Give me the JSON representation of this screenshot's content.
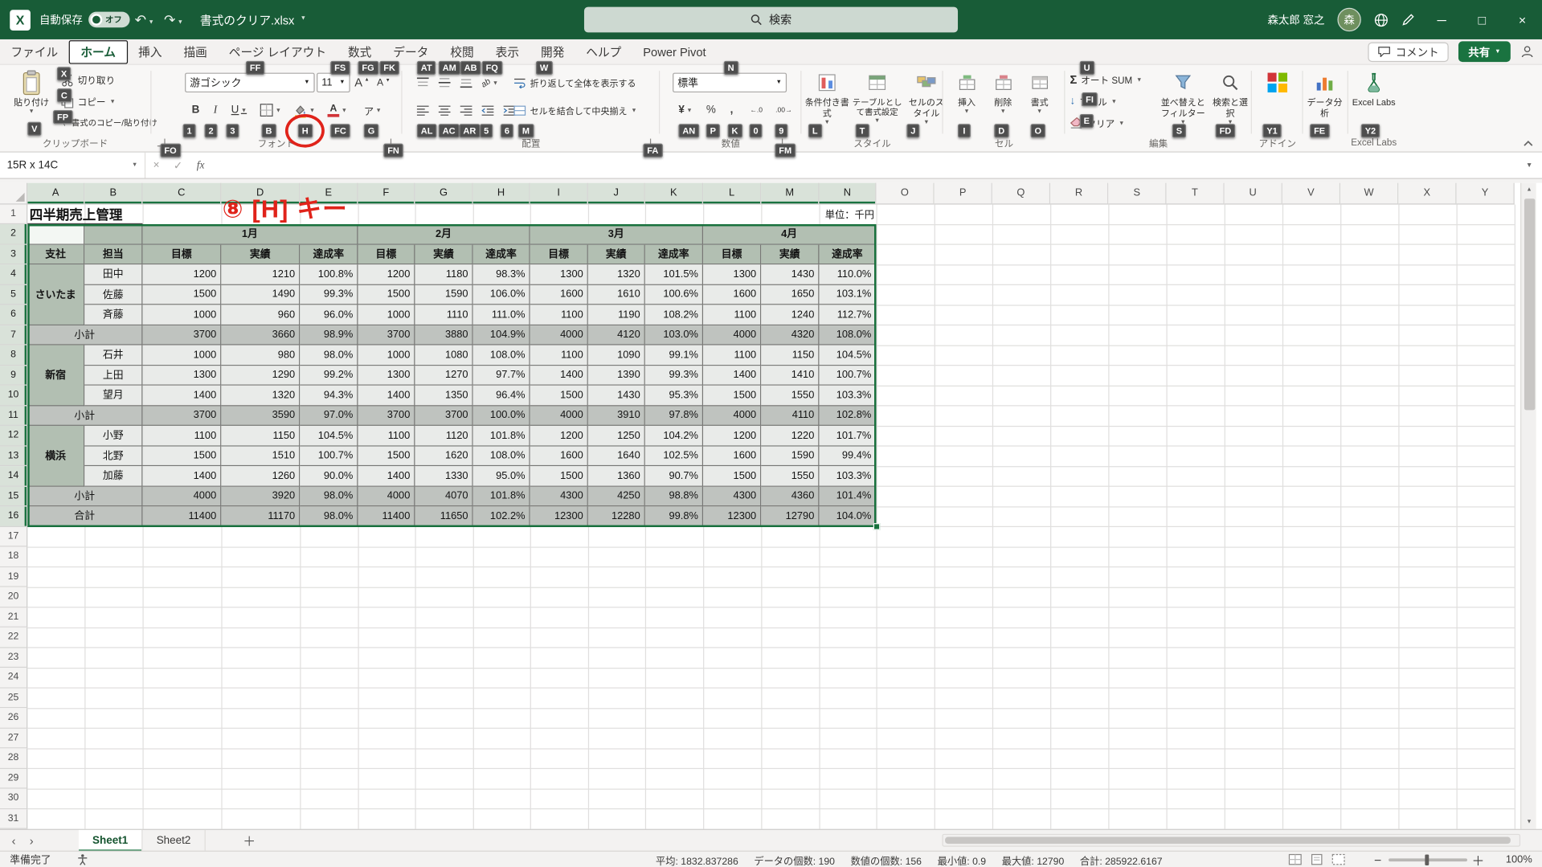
{
  "titlebar": {
    "autosave_label": "自動保存",
    "autosave_state": "オフ",
    "filename": "書式のクリア.xlsx",
    "search_placeholder": "検索",
    "user_name": "森太郎 窓之",
    "user_initial": "森"
  },
  "ribbon_tabs": {
    "items": [
      "ファイル",
      "ホーム",
      "挿入",
      "描画",
      "ページ レイアウト",
      "数式",
      "データ",
      "校閲",
      "表示",
      "開発",
      "ヘルプ",
      "Power Pivot"
    ],
    "active": "ホーム",
    "comments_label": "コメント",
    "share_label": "共有"
  },
  "ribbon": {
    "clipboard": {
      "title": "クリップボード",
      "paste": "貼り付け",
      "cut": "切り取り",
      "copy": "コピー",
      "format_painter": "書式のコピー/貼り付け"
    },
    "font": {
      "title": "フォント",
      "font_name": "游ゴシック",
      "font_size": "11",
      "bold": "B",
      "italic": "I",
      "underline": "U",
      "phonetic": "ア"
    },
    "alignment": {
      "title": "配置",
      "wrap_text": "折り返して全体を表示する",
      "merge_center": "セルを結合して中央揃え"
    },
    "number": {
      "title": "数値",
      "format": "標準",
      "currency": "¥",
      "percent": "%",
      "comma": ",",
      "inc": "←.0",
      "dec": ".00→"
    },
    "styles": {
      "title": "スタイル",
      "conditional": "条件付き書式",
      "format_table": "テーブルとして書式設定",
      "cell_styles": "セルのスタイル"
    },
    "cells": {
      "title": "セル",
      "insert": "挿入",
      "delete": "削除",
      "format": "書式"
    },
    "editing": {
      "title": "編集",
      "autosum": "オート SUM",
      "fill": "フィル",
      "clear": "クリア",
      "sort_filter": "並べ替えとフィルター",
      "find_select": "検索と選択"
    },
    "addins": {
      "title": "アドイン",
      "data_analysis": "データ分析",
      "excel_labs": "Excel Labs"
    }
  },
  "keytips": {
    "cut": "X",
    "copy": "C",
    "format_painter": "FP",
    "paste": "V",
    "clipboard_launcher": "FO",
    "font_name": "FF",
    "font_size": "FS",
    "grow_font": "FG",
    "shrink_font": "FK",
    "bold": "1",
    "italic": "2",
    "underline": "3",
    "borders": "B",
    "fill_color": "H",
    "font_color": "FC",
    "phonetic": "G",
    "font_launcher": "FN",
    "align_top": "AT",
    "align_middle": "AM",
    "align_bottom": "AB",
    "orientation": "FQ",
    "wrap_text": "W",
    "align_left": "AL",
    "align_center": "AC",
    "align_right": "AR",
    "outdent": "5",
    "indent": "6",
    "merge_center": "M",
    "alignment_launcher": "FA",
    "number_format": "N",
    "accounting": "AN",
    "percent": "P",
    "comma": "K",
    "increase_decimal": "0",
    "decrease_decimal": "9",
    "number_launcher": "FM",
    "conditional_formatting": "L",
    "format_as_table": "T",
    "cell_styles": "J",
    "insert": "I",
    "delete": "D",
    "format": "O",
    "autosum": "U",
    "fill": "FI",
    "clear": "E",
    "sort_filter": "S",
    "find_select": "FD",
    "addins": "Y1",
    "data_analysis": "FE",
    "excel_labs": "Y2"
  },
  "formula_bar": {
    "name_box": "15R x 14C",
    "fx": "fx"
  },
  "annotation": {
    "text": "⑧ [H] キー"
  },
  "sheet": {
    "columns": [
      "A",
      "B",
      "C",
      "D",
      "E",
      "F",
      "G",
      "H",
      "I",
      "J",
      "K",
      "L",
      "M",
      "N",
      "O",
      "P",
      "Q",
      "R",
      "S",
      "T",
      "U",
      "V",
      "W",
      "X",
      "Y"
    ],
    "rows": 31,
    "title_cell": "四半期売上管理",
    "unit_cell": "単位：千円"
  },
  "table": {
    "months": [
      "1月",
      "2月",
      "3月",
      "4月"
    ],
    "headers": {
      "branch": "支社",
      "person": "担当",
      "target": "目標",
      "actual": "実績",
      "rate": "達成率"
    },
    "groups": [
      {
        "branch": "さいたま",
        "members": [
          {
            "name": "田中",
            "values": [
              "1200",
              "1210",
              "100.8%",
              "1200",
              "1180",
              "98.3%",
              "1300",
              "1320",
              "101.5%",
              "1300",
              "1430",
              "110.0%"
            ]
          },
          {
            "name": "佐藤",
            "values": [
              "1500",
              "1490",
              "99.3%",
              "1500",
              "1590",
              "106.0%",
              "1600",
              "1610",
              "100.6%",
              "1600",
              "1650",
              "103.1%"
            ]
          },
          {
            "name": "斉藤",
            "values": [
              "1000",
              "960",
              "96.0%",
              "1000",
              "1110",
              "111.0%",
              "1100",
              "1190",
              "108.2%",
              "1100",
              "1240",
              "112.7%"
            ]
          }
        ],
        "subtotal_label": "小計",
        "subtotal": [
          "3700",
          "3660",
          "98.9%",
          "3700",
          "3880",
          "104.9%",
          "4000",
          "4120",
          "103.0%",
          "4000",
          "4320",
          "108.0%"
        ]
      },
      {
        "branch": "新宿",
        "members": [
          {
            "name": "石井",
            "values": [
              "1000",
              "980",
              "98.0%",
              "1000",
              "1080",
              "108.0%",
              "1100",
              "1090",
              "99.1%",
              "1100",
              "1150",
              "104.5%"
            ]
          },
          {
            "name": "上田",
            "values": [
              "1300",
              "1290",
              "99.2%",
              "1300",
              "1270",
              "97.7%",
              "1400",
              "1390",
              "99.3%",
              "1400",
              "1410",
              "100.7%"
            ]
          },
          {
            "name": "望月",
            "values": [
              "1400",
              "1320",
              "94.3%",
              "1400",
              "1350",
              "96.4%",
              "1500",
              "1430",
              "95.3%",
              "1500",
              "1550",
              "103.3%"
            ]
          }
        ],
        "subtotal_label": "小計",
        "subtotal": [
          "3700",
          "3590",
          "97.0%",
          "3700",
          "3700",
          "100.0%",
          "4000",
          "3910",
          "97.8%",
          "4000",
          "4110",
          "102.8%"
        ]
      },
      {
        "branch": "横浜",
        "members": [
          {
            "name": "小野",
            "values": [
              "1100",
              "1150",
              "104.5%",
              "1100",
              "1120",
              "101.8%",
              "1200",
              "1250",
              "104.2%",
              "1200",
              "1220",
              "101.7%"
            ]
          },
          {
            "name": "北野",
            "values": [
              "1500",
              "1510",
              "100.7%",
              "1500",
              "1620",
              "108.0%",
              "1600",
              "1640",
              "102.5%",
              "1600",
              "1590",
              "99.4%"
            ]
          },
          {
            "name": "加藤",
            "values": [
              "1400",
              "1260",
              "90.0%",
              "1400",
              "1330",
              "95.0%",
              "1500",
              "1360",
              "90.7%",
              "1500",
              "1550",
              "103.3%"
            ]
          }
        ],
        "subtotal_label": "小計",
        "subtotal": [
          "4000",
          "3920",
          "98.0%",
          "4000",
          "4070",
          "101.8%",
          "4300",
          "4250",
          "98.8%",
          "4300",
          "4360",
          "101.4%"
        ]
      }
    ],
    "total_label": "合計",
    "total": [
      "11400",
      "11170",
      "98.0%",
      "11400",
      "11650",
      "102.2%",
      "12300",
      "12280",
      "99.8%",
      "12300",
      "12790",
      "104.0%"
    ]
  },
  "sheet_tabs": {
    "tabs": [
      "Sheet1",
      "Sheet2"
    ],
    "active": "Sheet1"
  },
  "status_bar": {
    "ready": "準備完了",
    "stats": [
      {
        "label": "平均",
        "value": "1832.837286"
      },
      {
        "label": "データの個数",
        "value": "190"
      },
      {
        "label": "数値の個数",
        "value": "156"
      },
      {
        "label": "最小値",
        "value": "0.9"
      },
      {
        "label": "最大値",
        "value": "12790"
      },
      {
        "label": "合計",
        "value": "285922.6167"
      }
    ],
    "zoom": "100%"
  }
}
